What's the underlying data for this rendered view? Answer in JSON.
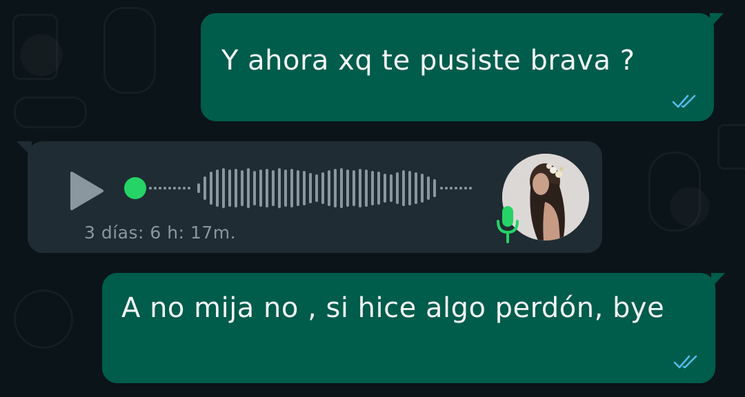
{
  "messages": [
    {
      "id": "msg1",
      "direction": "outgoing",
      "text": "Y ahora xq te pusiste brava ?",
      "status_icon": "double-check-read-icon"
    },
    {
      "id": "voice",
      "direction": "incoming",
      "type": "voice-note",
      "duration": "3 días: 6 h: 17m.",
      "icons": [
        "play-icon",
        "microphone-icon"
      ]
    },
    {
      "id": "msg2",
      "direction": "outgoing",
      "text": "A no mija no , si hice algo perdón, bye",
      "status_icon": "double-check-read-icon"
    }
  ],
  "colors": {
    "background": "#0b1418",
    "outgoing_bubble": "#005c4b",
    "incoming_bubble": "#202c33",
    "read_tick": "#53bdeb",
    "playhead": "#25d366",
    "mic": "#25d366",
    "waveform": "#8a979e"
  }
}
